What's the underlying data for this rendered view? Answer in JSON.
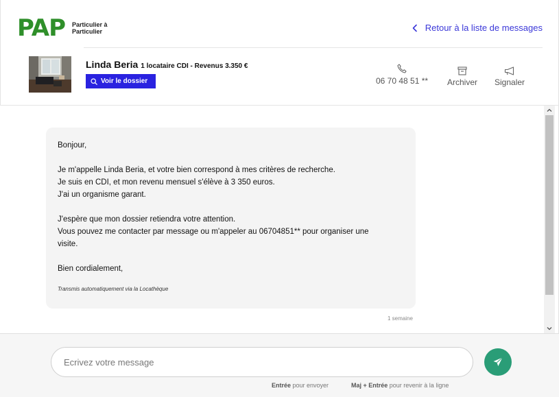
{
  "brand": {
    "logo": "PAP",
    "tagline_line1": "Particulier à",
    "tagline_line2": "Particulier",
    "color": "#2f8f2a"
  },
  "header": {
    "back_link": "Retour à la liste de messages",
    "accent": "#3a37d8"
  },
  "contact": {
    "name": "Linda Beria",
    "info": "1 locataire CDI - Revenus 3.350 €",
    "dossier_button": "Voir le dossier",
    "phone": "06 70 48 51 **",
    "archive": "Archiver",
    "report": "Signaler"
  },
  "message": {
    "lines": [
      "Bonjour,",
      "",
      "Je m'appelle Linda Beria, et votre bien correspond à mes critères de recherche.",
      "Je suis en CDI, et mon revenu mensuel s'élève à 3 350 euros.",
      "J'ai un organisme garant.",
      "",
      "J'espère que mon dossier retiendra votre attention.",
      "Vous pouvez me contacter par message ou m'appeler au 06704851** pour organiser une",
      "visite.",
      "",
      "Bien cordialement,"
    ],
    "note": "Transmis automatiquement via la Locathèque",
    "timestamp": "1 semaine"
  },
  "composer": {
    "placeholder": "Ecrivez votre message",
    "hint_send_key": "Entrée",
    "hint_send_text": " pour envoyer",
    "hint_newline_key": "Maj + Entrée",
    "hint_newline_text": " pour revenir à la ligne",
    "send_color": "#2a9d77"
  },
  "icons": {
    "back": "chevron-left-icon",
    "search": "search-icon",
    "phone": "phone-icon",
    "archive": "archive-icon",
    "report": "megaphone-icon",
    "send": "paper-plane-icon"
  }
}
